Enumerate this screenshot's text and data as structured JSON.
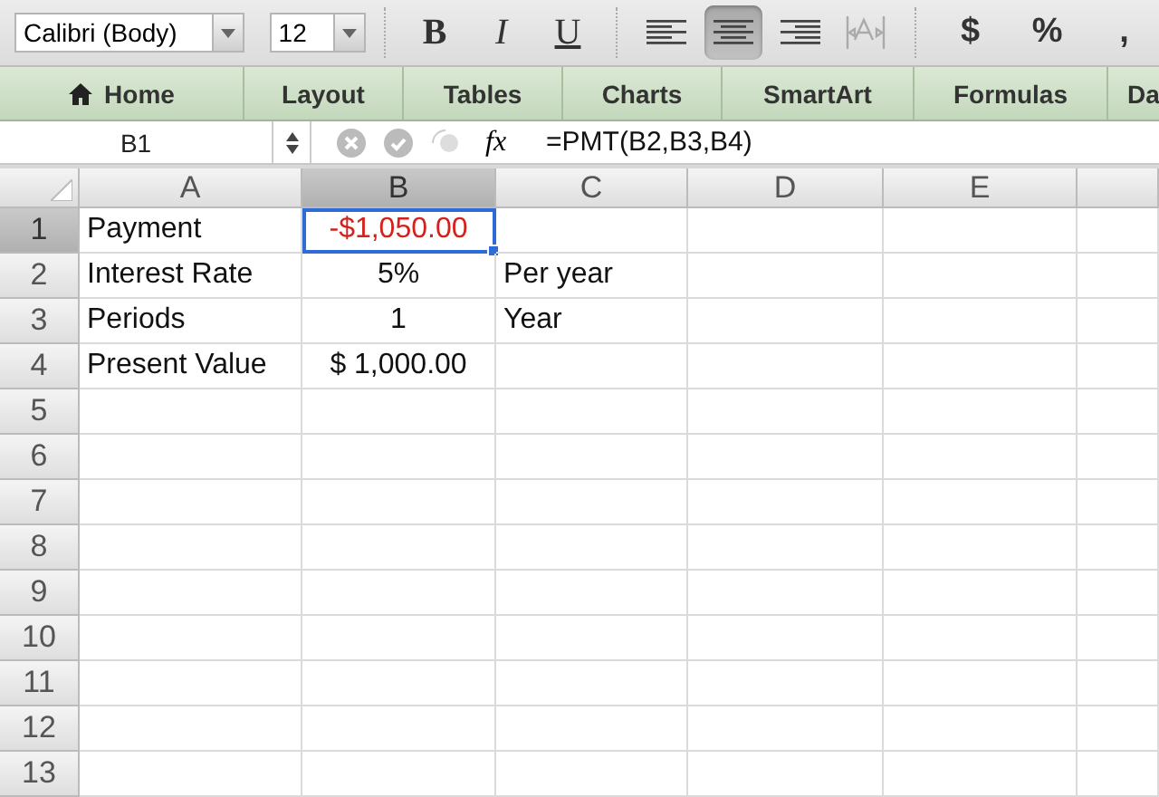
{
  "toolbar": {
    "font": "Calibri (Body)",
    "size": "12",
    "format_buttons": [
      {
        "label": "B",
        "kind": "bold"
      },
      {
        "label": "I",
        "kind": "italic"
      },
      {
        "label": "U",
        "kind": "underline"
      }
    ],
    "align_buttons": [
      {
        "kind": "left",
        "selected": false
      },
      {
        "kind": "center",
        "selected": true
      },
      {
        "kind": "right",
        "selected": false
      },
      {
        "kind": "wrap",
        "selected": false
      }
    ],
    "number_buttons": [
      "$",
      "%",
      ","
    ]
  },
  "tabs": [
    {
      "label": "Home",
      "kind": "home"
    },
    {
      "label": "Layout",
      "kind": "plain"
    },
    {
      "label": "Tables",
      "kind": "plain"
    },
    {
      "label": "Charts",
      "kind": "plain"
    },
    {
      "label": "SmartArt",
      "kind": "plain"
    },
    {
      "label": "Formulas",
      "kind": "plain"
    },
    {
      "label": "Da",
      "kind": "plain"
    }
  ],
  "formula_bar": {
    "name_box": "B1",
    "function_label": "fx",
    "formula": "=PMT(B2,B3,B4)"
  },
  "grid": {
    "columns": [
      {
        "label": "A",
        "selected": false
      },
      {
        "label": "B",
        "selected": true
      },
      {
        "label": "C",
        "selected": false
      },
      {
        "label": "D",
        "selected": false
      },
      {
        "label": "E",
        "selected": false
      }
    ],
    "rows": [
      {
        "label": "1",
        "selected": true,
        "cells": {
          "A": {
            "text": "Payment",
            "selected": false,
            "negative": false
          },
          "B": {
            "text": "-$1,050.00",
            "selected": true,
            "negative": true
          }
        }
      },
      {
        "label": "2",
        "selected": false,
        "cells": {
          "A": {
            "text": "Interest Rate",
            "selected": false,
            "negative": false
          },
          "B": {
            "text": "5%",
            "selected": false,
            "negative": false
          },
          "C": {
            "text": "Per year",
            "selected": false,
            "negative": false
          }
        }
      },
      {
        "label": "3",
        "selected": false,
        "cells": {
          "A": {
            "text": "Periods",
            "selected": false,
            "negative": false
          },
          "B": {
            "text": "1",
            "selected": false,
            "negative": false
          },
          "C": {
            "text": "Year",
            "selected": false,
            "negative": false
          }
        }
      },
      {
        "label": "4",
        "selected": false,
        "cells": {
          "A": {
            "text": "Present Value",
            "selected": false,
            "negative": false
          },
          "B": {
            "text": "$ 1,000.00",
            "selected": false,
            "negative": false
          }
        }
      },
      {
        "label": "5",
        "selected": false
      },
      {
        "label": "6",
        "selected": false
      },
      {
        "label": "7",
        "selected": false
      },
      {
        "label": "8",
        "selected": false
      },
      {
        "label": "9",
        "selected": false
      },
      {
        "label": "10",
        "selected": false
      },
      {
        "label": "11",
        "selected": false
      },
      {
        "label": "12",
        "selected": false
      },
      {
        "label": "13",
        "selected": false
      }
    ]
  }
}
